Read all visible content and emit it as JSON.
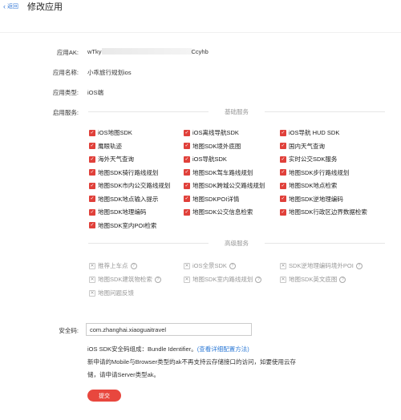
{
  "header": {
    "back_label": "返回",
    "title": "修改应用"
  },
  "form": {
    "ak_label": "应用AK:",
    "ak_value_prefix": "wTky",
    "ak_value_suffix": "Ccyhb",
    "name_label": "应用名称:",
    "name_value": "小乖旅行规划ios",
    "type_label": "应用类型:",
    "type_value": "iOS端",
    "service_label": "启用服务:",
    "basic_title": "基础服务",
    "basic_services": [
      "iOS地图SDK",
      "iOS离线导航SDK",
      "iOS导航 HUD SDK",
      "鹰眼轨迹",
      "地图SDK境外底图",
      "国内天气查询",
      "海外天气查询",
      "iOS导航SDK",
      "实时公交SDK服务",
      "地图SDK骑行路线规划",
      "地图SDK驾车路线规划",
      "地图SDK步行路线规划",
      "地图SDK市内公交路线规划",
      "地图SDK跨城公交路线规划",
      "地图SDK地点检索",
      "地图SDK地点输入提示",
      "地图SDKPOI详情",
      "地图SDK逆地理编码",
      "地图SDK地理编码",
      "地图SDK公交信息检索",
      "地图SDK行政区边界数据检索",
      "地图SDK室内POI检索"
    ],
    "advanced_title": "高级服务",
    "advanced_services": [
      "推荐上车点",
      "iOS全景SDK",
      "SDK逆地理编码境外POI",
      "地图SDK建筑物检索",
      "地图SDK室内路线规划",
      "地图SDK英文底图",
      "地图问题反馈"
    ],
    "help_icon": "?",
    "check_icon": "✓",
    "x_icon": "✕",
    "safe_code_label": "安全码:",
    "safe_code_value": "com.zhanghai.xiaoguaitravel",
    "info_line1_prefix": "iOS SDK安全码组成：Bundle Identifier。",
    "info_line1_link": "(查看详细配置方法)",
    "info_line2": "新申请的Mobile与Browser类型的ak不再支持云存储接口的访问，如要使用云存",
    "info_line3": "储，请申请Server类型ak。",
    "submit_label": "提交"
  },
  "colors": {
    "accent": "#e0403a",
    "link": "#2f7bd6"
  }
}
